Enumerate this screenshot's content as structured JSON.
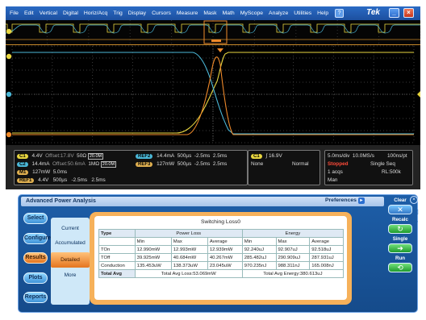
{
  "menu": {
    "items": [
      "File",
      "Edit",
      "Vertical",
      "Digital",
      "Horiz/Acq",
      "Trig",
      "Display",
      "Cursors",
      "Measure",
      "Mask",
      "Math",
      "MyScope",
      "Analyze",
      "Utilities",
      "Help"
    ],
    "help_icon": "question-icon",
    "brand": "Tek"
  },
  "colors": {
    "ch1": "#e8d640",
    "ch2": "#4bb8d8",
    "math": "#f08a2a",
    "menubar": "#2a6bc4",
    "panel": "#1d5ea8",
    "accent": "#e5751f"
  },
  "readouts": {
    "ch1": {
      "badge": "C1",
      "scale": "4.4V",
      "offset": "Offset:17.8V",
      "imp": "50Ω",
      "bw": "20.0M"
    },
    "ch2": {
      "badge": "C2",
      "scale": "14.4mA",
      "offset": "Offset:50.6mA",
      "imp": "1MΩ",
      "bw": "20.0M"
    },
    "math1": {
      "badge": "M1",
      "scale": "127mW",
      "time": "5.0ms"
    },
    "ref1": {
      "badge": "REF1",
      "scale": "4.4V",
      "time": "500µs",
      "pos1": "-2.5ms",
      "pos2": "2.5ms"
    },
    "ref2": {
      "badge": "REF2",
      "scale": "14.4mA",
      "time": "500µs",
      "pos1": "-2.5ms",
      "pos2": "2.5ms"
    },
    "ref3": {
      "badge": "REF3",
      "scale": "127mW",
      "time": "500µs",
      "pos1": "-2.5ms",
      "pos2": "2.5ms"
    },
    "trigger": {
      "source": "C1",
      "level": "16.9V",
      "coupling": "None",
      "mode": "Normal"
    },
    "horiz": {
      "scale": "5.0ms/div",
      "rate": "10.0MS/s",
      "res": "100ns/pt",
      "state": "Stopped",
      "seq": "Single Seq",
      "acqs": "1 acqs",
      "rl": "RL:500k",
      "man": "Man"
    }
  },
  "panel": {
    "title": "Advanced Power Analysis",
    "preferences": "Preferences",
    "side_buttons": [
      "Select",
      "Configure",
      "Results",
      "Plots",
      "Reports"
    ],
    "active_side": "Results",
    "tabs": [
      "Current",
      "Accumulated",
      "Detailed",
      "More"
    ],
    "selected_tab": "Detailed",
    "right": {
      "clear": "Clear",
      "recalc": "Recalc",
      "single": "Single",
      "run": "Run"
    }
  },
  "results": {
    "title": "Switching Loss0",
    "col_type": "Type",
    "group_power": "Power Loss",
    "group_energy": "Energy",
    "sub_headers": [
      "Min",
      "Max",
      "Average",
      "Min",
      "Max",
      "Average"
    ],
    "rows": [
      {
        "type": "TOn",
        "values": [
          "12.990mW",
          "12.993mW",
          "12.939mW",
          "92.240uJ",
          "92.907uJ",
          "92.518uJ"
        ]
      },
      {
        "type": "TOff",
        "values": [
          "39.925mW",
          "40.684mW",
          "40.267mW",
          "285.482uJ",
          "290.909uJ",
          "287.931uJ"
        ]
      },
      {
        "type": "Conduction",
        "values": [
          "135.453uW",
          "138.373uW",
          "23.045uW",
          "970.235nJ",
          "988.311nJ",
          "165.008nJ"
        ]
      }
    ],
    "total_label": "Total Avg",
    "total_power": "Total Avg Loss:53.069mW",
    "total_energy": "Total Avg Energy:380.613uJ"
  }
}
